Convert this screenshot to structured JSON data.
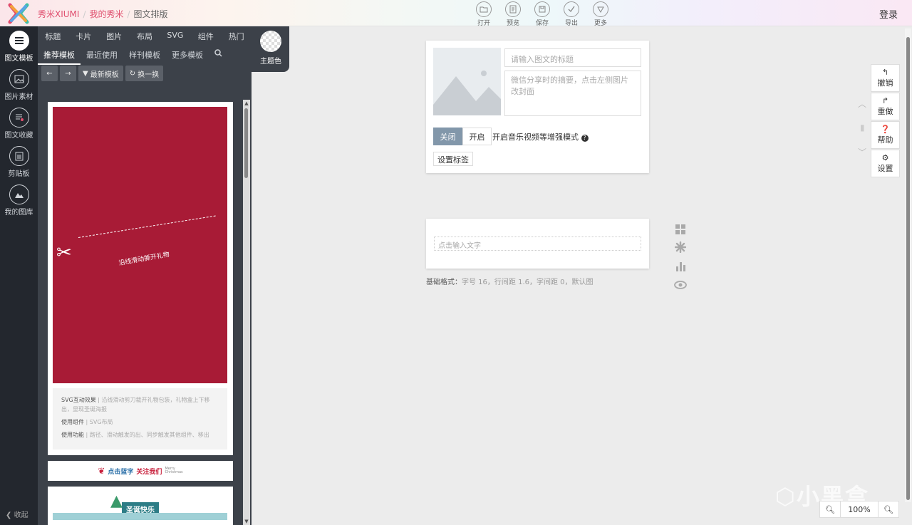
{
  "app": {
    "breadcrumb": [
      "秀米XIUMI",
      "我的秀米",
      "图文排版"
    ],
    "login": "登录"
  },
  "toolbar": {
    "open": "打开",
    "preview": "预览",
    "save": "保存",
    "export": "导出",
    "more": "更多"
  },
  "rail": {
    "items": [
      {
        "label": "图文模板",
        "icon": "list-icon"
      },
      {
        "label": "图片素材",
        "icon": "image-icon"
      },
      {
        "label": "图文收藏",
        "icon": "favorite-icon"
      },
      {
        "label": "剪贴板",
        "icon": "clipboard-icon"
      },
      {
        "label": "我的图库",
        "icon": "gallery-icon"
      }
    ],
    "collapse": "收起"
  },
  "panel": {
    "categories": [
      "标题",
      "卡片",
      "图片",
      "布局",
      "SVG",
      "组件",
      "热门"
    ],
    "subtabs": [
      "推荐模板",
      "最近使用",
      "样刊模板",
      "更多模板"
    ],
    "theme": "主题色",
    "latest": "最新模板",
    "shuffle": "换一换"
  },
  "template1": {
    "art_text": "沿线滑动撕开礼物",
    "effect_key": "SVG互动效果",
    "effect_val": "沿线滑动剪刀裁开礼物包装，礼物盒上下移出，显现圣诞海报",
    "comp_key": "使用组件",
    "comp_val": "SVG布局",
    "func_key": "使用功能",
    "func_val": "路径、滑动触发的出、同步触发其他组件、移出"
  },
  "template2": {
    "blue": "点击蓝字",
    "red": "关注我们",
    "small1": "Merry",
    "small2": "Christmas"
  },
  "template3": {
    "title": "圣诞快乐"
  },
  "editor": {
    "title_placeholder": "请输入图文的标题",
    "summary_placeholder": "微信分享时的摘要，点击左侧图片改封面",
    "off": "关闭",
    "on": "开启",
    "enhance": "开启音乐视频等增强模式",
    "tag": "设置标签",
    "text_placeholder": "点击输入文字",
    "base_label": "基础格式：",
    "base_value": "字号 16，行间距 1.6，字间距 0，默认图"
  },
  "right": {
    "undo": "撤销",
    "redo": "重做",
    "help": "帮助",
    "settings": "设置"
  },
  "zoom": {
    "value": "100%"
  },
  "watermark": "小黑盒",
  "colors": {
    "accent": "#e0506f",
    "rail_bg": "#23272e",
    "panel_bg": "#3c4149",
    "template_red": "#a81b36"
  }
}
